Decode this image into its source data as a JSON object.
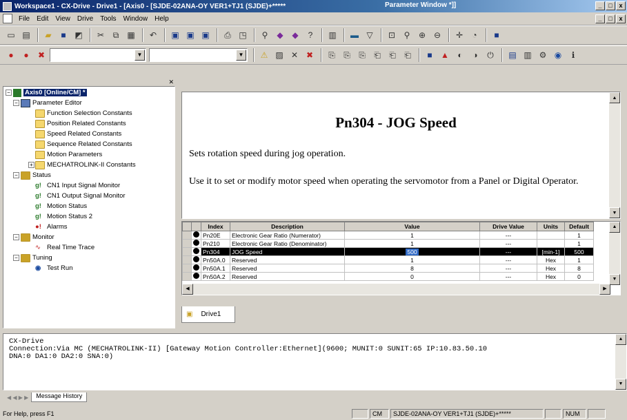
{
  "title": {
    "left": "Workspace1 - CX-Drive - Drive1 - [Axis0 - [SJDE-02ANA-OY VER1+TJ1 (SJDE)+*****",
    "right": "Parameter Window *]]"
  },
  "window_buttons": {
    "minimize": "_",
    "maximize": "□",
    "close": "x"
  },
  "menu": [
    "File",
    "Edit",
    "View",
    "Drive",
    "Tools",
    "Window",
    "Help"
  ],
  "tree": {
    "root": "Axis0 [Online/CM] *",
    "parameter_editor": "Parameter Editor",
    "items": [
      "Function Selection Constants",
      "Position Related Constants",
      "Speed Related Constants",
      "Sequence Related Constants",
      "Motion Parameters",
      "MECHATROLINK-II Constants"
    ],
    "status": "Status",
    "status_items": [
      "CN1 Input Signal Monitor",
      "CN1 Output Signal Monitor",
      "Motion Status",
      "Motion Status 2",
      "Alarms"
    ],
    "monitor": "Monitor",
    "monitor_items": [
      "Real Time Trace"
    ],
    "tuning": "Tuning",
    "tuning_items": [
      "Test Run"
    ]
  },
  "help": {
    "title": "Pn304 - JOG Speed",
    "p1": "Sets rotation speed during jog operation.",
    "p2": "Use it to set or modify motor speed when operating the servomotor from a Panel or Digital Operator."
  },
  "grid": {
    "headers": [
      "Index",
      "Description",
      "Value",
      "Drive Value",
      "Units",
      "Default"
    ],
    "rows": [
      [
        "Pn20E",
        "Electronic Gear Ratio (Numerator)",
        "1",
        "---",
        "",
        "1"
      ],
      [
        "Pn210",
        "Electronic Gear Ratio (Denominator)",
        "1",
        "---",
        "",
        "1"
      ],
      [
        "Pn304",
        "JOG Speed",
        "500",
        "---",
        "[min-1]",
        "500"
      ],
      [
        "Pn50A.0",
        "Reserved",
        "1",
        "---",
        "Hex",
        "1"
      ],
      [
        "Pn50A.1",
        "Reserved",
        "8",
        "---",
        "Hex",
        "8"
      ],
      [
        "Pn50A.2",
        "Reserved",
        "0",
        "---",
        "Hex",
        "0"
      ]
    ]
  },
  "doc_tab": "Drive1",
  "output": {
    "lines": [
      "CX-Drive",
      "Connection:Via MC (MECHATROLINK-II) [Gateway Motion Controller:Ethernet](9600; MUNIT:0 SUNIT:65 IP:10.83.50.10",
      "DNA:0 DA1:0 DA2:0 SNA:0)"
    ],
    "tab": "Message History"
  },
  "status": {
    "help": "For Help, press F1",
    "cm": "CM",
    "device": "SJDE-02ANA-OY VER1+TJ1 (SJDE)+*****",
    "num": "NUM"
  }
}
